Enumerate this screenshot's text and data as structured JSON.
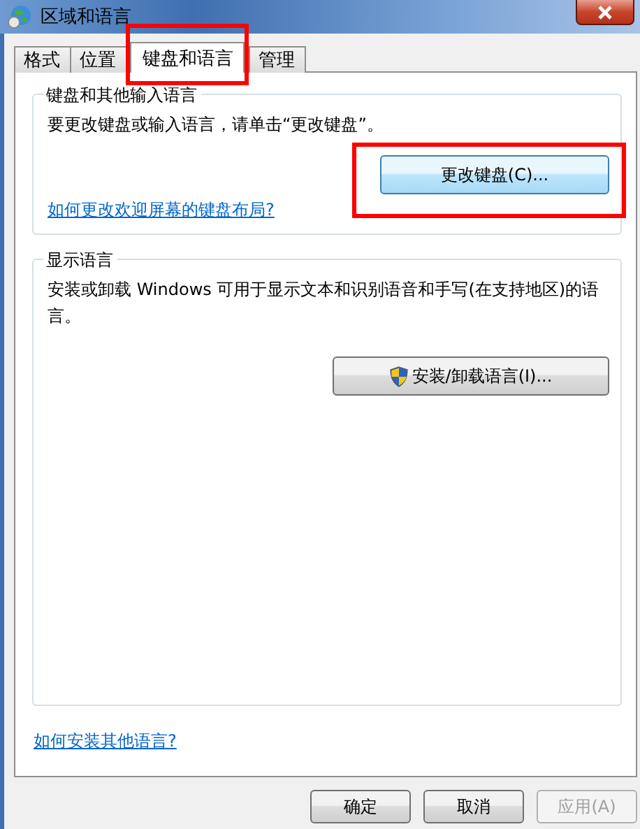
{
  "window": {
    "title": "区域和语言"
  },
  "tabs": [
    {
      "label": "格式",
      "selected": false,
      "highlighted": false
    },
    {
      "label": "位置",
      "selected": false,
      "highlighted": false
    },
    {
      "label": "键盘和语言",
      "selected": true,
      "highlighted": true
    },
    {
      "label": "管理",
      "selected": false,
      "highlighted": false
    }
  ],
  "keyboard_group": {
    "title": "键盘和其他输入语言",
    "text": "要更改键盘或输入语言，请单击“更改键盘”。",
    "button": {
      "label": "更改键盘(C)...",
      "focused": true,
      "highlighted": true
    },
    "link": "如何更改欢迎屏幕的键盘布局?"
  },
  "display_group": {
    "title": "显示语言",
    "text": "安装或卸载 Windows 可用于显示文本和识别语音和手写(在支持地区)的语言。",
    "button": {
      "label": "安装/卸载语言(I)...",
      "focused": false
    }
  },
  "link": "如何安装其他语言?",
  "buttons": [
    {
      "label": "确定",
      "disabled": false
    },
    {
      "label": "取消",
      "disabled": false
    },
    {
      "label": "应用(A)",
      "disabled": true
    }
  ]
}
